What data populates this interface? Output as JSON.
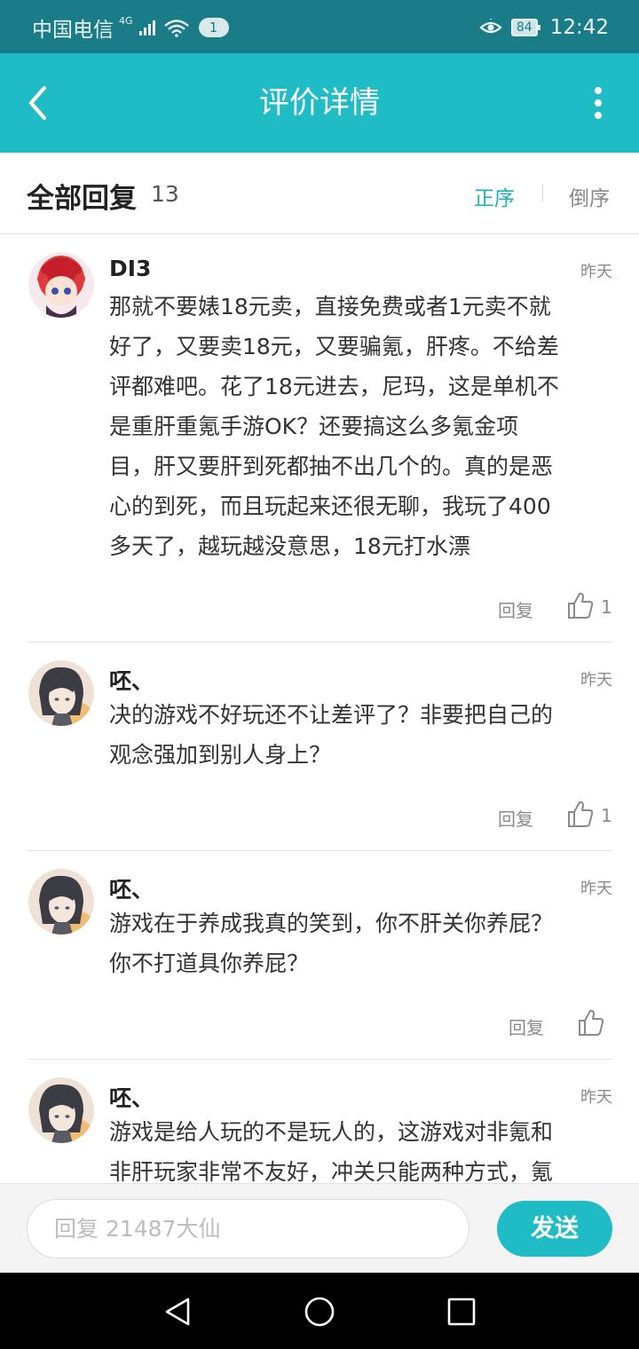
{
  "status_bar": {
    "carrier": "中国电信",
    "network": "4G",
    "notification_count": "1",
    "battery": "84",
    "time": "12:42"
  },
  "header": {
    "title": "评价详情"
  },
  "replies_header": {
    "title": "全部回复",
    "count": "13",
    "sort_ascending": "正序",
    "sort_descending": "倒序"
  },
  "comments": [
    {
      "username": "DI3",
      "time": "昨天",
      "lines": [
        "那就不要婊18元卖，直接免费或者1元卖不就",
        "好了，又要卖18元，又要骗氪，肝疼。不给差",
        "评都难吧。花了18元进去，尼玛，这是单机不",
        "是重肝重氪手游OK？还要搞这么多氪金项",
        "目，肝又要肝到死都抽不出几个的。真的是恶",
        "心的到死，而且玩起来还很无聊，我玩了400",
        "多天了，越玩越没意思，18元打水漂"
      ],
      "reply_label": "回复",
      "likes": "1"
    },
    {
      "username": "呸、",
      "time": "昨天",
      "lines": [
        "决的游戏不好玩还不让差评了？非要把自己的",
        "观念强加到别人身上？"
      ],
      "reply_label": "回复",
      "likes": "1"
    },
    {
      "username": "呸、",
      "time": "昨天",
      "lines": [
        "游戏在于养成我真的笑到，你不肝关你养屁？",
        "你不打道具你养屁？"
      ],
      "reply_label": "回复",
      "likes": ""
    },
    {
      "username": "呸、",
      "time": "昨天",
      "lines": [
        "游戏是给人玩的不是玩人的，这游戏对非氪和",
        "非肝玩家非常不友好，冲关只能两种方式，氪"
      ]
    }
  ],
  "input_bar": {
    "placeholder": "回复 21487大仙",
    "send_label": "发送"
  },
  "colors": {
    "accent": "#20bcc6",
    "status_bar": "#1a7c87",
    "sort_active": "#20aeb9"
  },
  "icons": {
    "back": "back-arrow-icon",
    "more": "more-vertical-icon",
    "like": "thumbs-up-icon",
    "nav_back": "triangle-back-icon",
    "nav_home": "circle-home-icon",
    "nav_recent": "square-recent-icon"
  }
}
